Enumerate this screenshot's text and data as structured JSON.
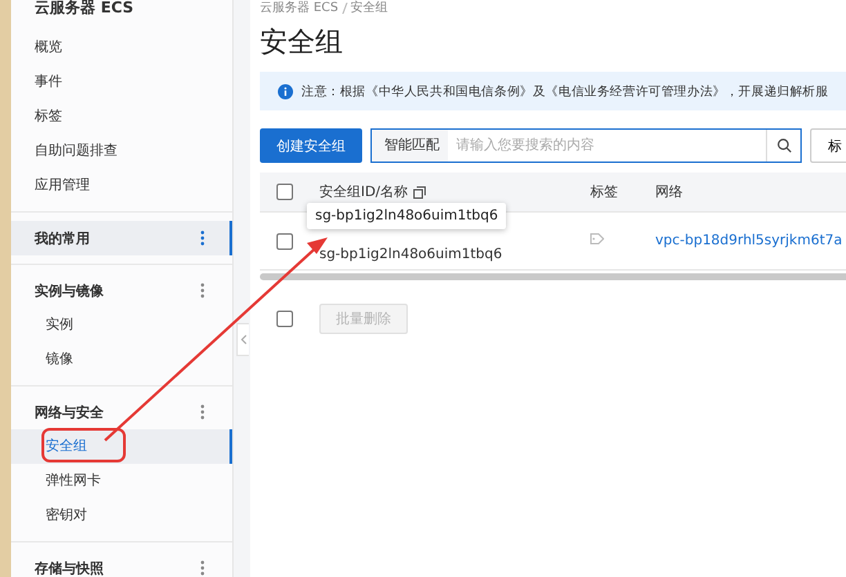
{
  "sidebar": {
    "title": "云服务器 ECS",
    "top_items": [
      {
        "label": "概览",
        "selected": false
      },
      {
        "label": "事件",
        "selected": false
      },
      {
        "label": "标签",
        "selected": false
      },
      {
        "label": "自助问题排查",
        "selected": false
      },
      {
        "label": "应用管理",
        "selected": false
      }
    ],
    "sections": [
      {
        "label": "我的常用",
        "selected": true
      },
      {
        "label": "实例与镜像",
        "selected": false,
        "children": [
          {
            "label": "实例",
            "selected": false
          },
          {
            "label": "镜像",
            "selected": false
          }
        ]
      },
      {
        "label": "网络与安全",
        "selected": false,
        "children": [
          {
            "label": "安全组",
            "selected": true
          },
          {
            "label": "弹性网卡",
            "selected": false
          },
          {
            "label": "密钥对",
            "selected": false
          }
        ]
      },
      {
        "label": "存储与快照",
        "selected": false
      }
    ]
  },
  "breadcrumb": [
    "云服务器 ECS",
    "安全组"
  ],
  "page_title": "安全组",
  "notice": "注意：根据《中华人民共和国电信条例》及《电信业务经营许可管理办法》，开展递归解析服",
  "toolbar": {
    "create_button": "创建安全组",
    "search_mode": "智能匹配",
    "search": {
      "placeholder": "请输入您要搜索的内容"
    },
    "tag_button": "标"
  },
  "table": {
    "select_all_checked": false,
    "columns": [
      "安全组ID/名称",
      "标签",
      "网络"
    ],
    "rows": [
      {
        "checked": false,
        "name": "sg-bp1ig2ln48o6uim1tbq6",
        "network": "vpc-bp18d9rhl5syrjkm6t7a"
      }
    ]
  },
  "tooltip": "sg-bp1ig2ln48o6uim1tbq6",
  "footer": {
    "select_all_checked": false,
    "bulk_delete": {
      "label": "批量删除",
      "disabled": true
    }
  }
}
